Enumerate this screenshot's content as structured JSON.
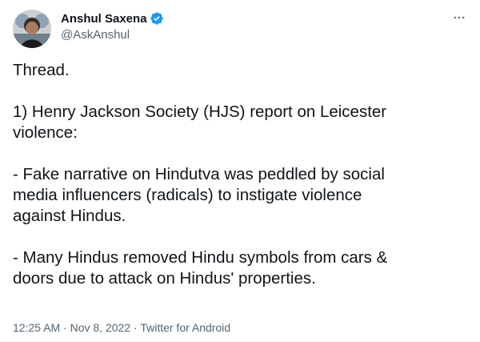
{
  "author": {
    "display_name": "Anshul Saxena",
    "handle": "@AskAnshul",
    "verified": true,
    "avatar_icon": "profile-photo",
    "verified_icon": "verified-badge-icon",
    "verified_color": "#1d9bf0"
  },
  "more_icon": "more-options-icon",
  "tweet": {
    "paragraphs": [
      [
        "Thread."
      ],
      [
        "1) Henry Jackson Society (HJS) report on Leicester",
        "violence:"
      ],
      [
        "- Fake narrative on Hindutva was peddled by social",
        "media influencers (radicals) to instigate violence",
        "against Hindus."
      ],
      [
        "- Many Hindus removed Hindu symbols from cars &",
        "doors due to attack on Hindus' properties."
      ]
    ]
  },
  "meta": {
    "time": "12:25 AM",
    "separator": "·",
    "date": "Nov 8, 2022",
    "source": "Twitter for Android"
  },
  "colors": {
    "text": "#0f1419",
    "secondary": "#536471",
    "accent": "#1d9bf0"
  }
}
